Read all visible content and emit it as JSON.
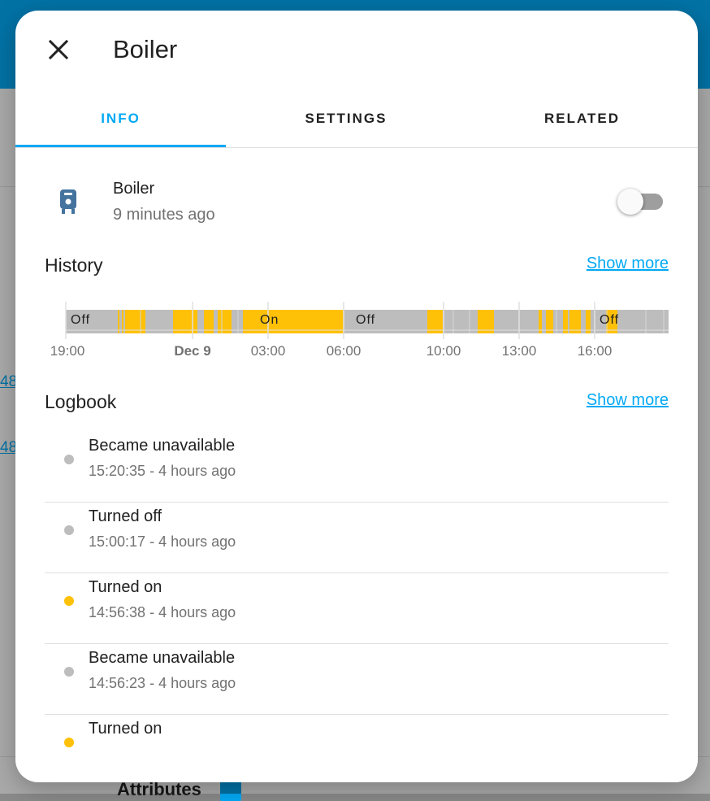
{
  "background": {
    "links": [
      "48",
      "48"
    ],
    "attributes_label": "Attributes"
  },
  "dialog": {
    "title": "Boiler",
    "close_icon": "close-icon"
  },
  "tabs": [
    {
      "label": "INFO",
      "active": true
    },
    {
      "label": "SETTINGS",
      "active": false
    },
    {
      "label": "RELATED",
      "active": false
    }
  ],
  "entity": {
    "name": "Boiler",
    "last_changed": "9 minutes ago",
    "icon": "water-boiler-icon",
    "state_on": false
  },
  "history": {
    "title": "History",
    "show_more": "Show more",
    "colors": {
      "on": "#ffc107",
      "off": "#bdbdbd"
    },
    "axis_ticks": [
      "19:00",
      "Dec 9",
      "03:00",
      "06:00",
      "10:00",
      "13:00",
      "16:00"
    ],
    "state_labels": [
      "Off",
      "On",
      "Off",
      "Off"
    ]
  },
  "logbook": {
    "title": "Logbook",
    "show_more": "Show more",
    "entries": [
      {
        "message": "Became unavailable",
        "time": "15:20:35 - 4 hours ago",
        "color": "#bdbdbd"
      },
      {
        "message": "Turned off",
        "time": "15:00:17 - 4 hours ago",
        "color": "#bdbdbd"
      },
      {
        "message": "Turned on",
        "time": "14:56:38 - 4 hours ago",
        "color": "#ffc107"
      },
      {
        "message": "Became unavailable",
        "time": "14:56:23 - 4 hours ago",
        "color": "#bdbdbd"
      },
      {
        "message": "Turned on",
        "time": "",
        "color": "#ffc107"
      }
    ]
  }
}
